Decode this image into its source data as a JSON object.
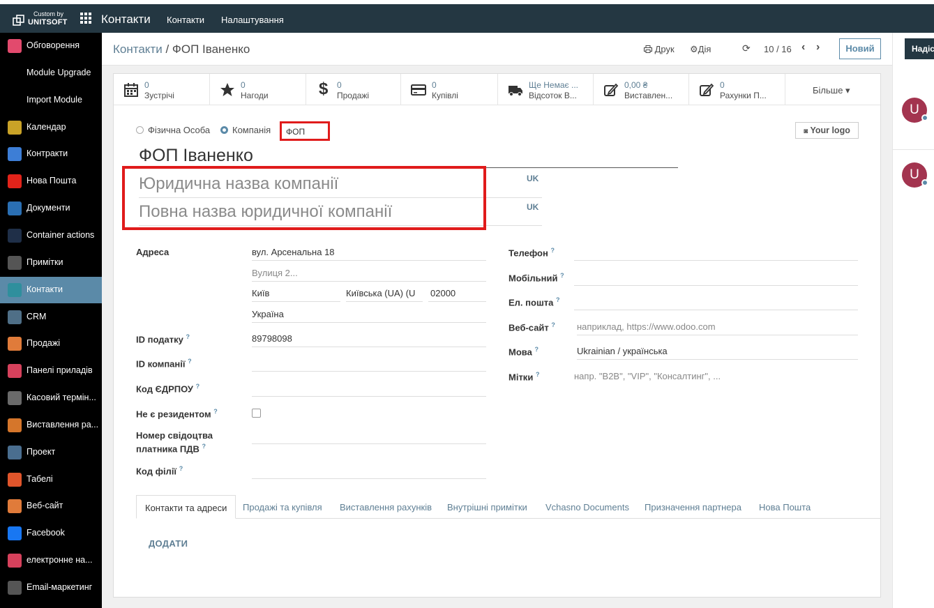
{
  "navbar": {
    "brand_small": "Custom by",
    "brand_big": "UNITSOFT",
    "title": "Контакти",
    "menu": [
      "Контакти",
      "Налаштування"
    ]
  },
  "sidebar": {
    "items": [
      {
        "label": "Обговорення",
        "icon": "chat-icon",
        "color": "#e24a6d"
      },
      {
        "label": "Module Upgrade",
        "icon": "none",
        "color": "#000000"
      },
      {
        "label": "Import Module",
        "icon": "none",
        "color": "#000000"
      },
      {
        "label": "Календар",
        "icon": "calendar-icon",
        "color": "#c9a227"
      },
      {
        "label": "Контракти",
        "icon": "contract-icon",
        "color": "#3d7ed6"
      },
      {
        "label": "Нова Пошта",
        "icon": "nova-poshta-icon",
        "color": "#e2231a"
      },
      {
        "label": "Документи",
        "icon": "documents-icon",
        "color": "#2a6fb3"
      },
      {
        "label": "Container actions",
        "icon": "container-icon",
        "color": "#1f2f48"
      },
      {
        "label": "Примітки",
        "icon": "notes-icon",
        "color": "#555555"
      },
      {
        "label": "Контакти",
        "icon": "contacts-icon",
        "color": "#2f8f9d",
        "active": true
      },
      {
        "label": "CRM",
        "icon": "crm-icon",
        "color": "#4f6f87"
      },
      {
        "label": "Продажі",
        "icon": "sales-icon",
        "color": "#e07b3a"
      },
      {
        "label": "Панелі приладів",
        "icon": "dashboard-icon",
        "color": "#d6415c"
      },
      {
        "label": "Касовий термін...",
        "icon": "pos-icon",
        "color": "#6a6a6a"
      },
      {
        "label": "Виставлення ра...",
        "icon": "invoicing-icon",
        "color": "#d5762b"
      },
      {
        "label": "Проект",
        "icon": "project-icon",
        "color": "#4a6e8f"
      },
      {
        "label": "Табелі",
        "icon": "timesheet-icon",
        "color": "#e0552b"
      },
      {
        "label": "Веб-сайт",
        "icon": "website-icon",
        "color": "#e07b3a"
      },
      {
        "label": "Facebook",
        "icon": "meta-icon",
        "color": "#1877f2"
      },
      {
        "label": "електронне на...",
        "icon": "e-doc-icon",
        "color": "#d6415c"
      },
      {
        "label": "Email-маркетинг",
        "icon": "email-marketing-icon",
        "color": "#555555"
      }
    ]
  },
  "control_panel": {
    "breadcrumb_link": "Контакти",
    "breadcrumb_sep": "/",
    "breadcrumb_current": "ФОП Іваненко",
    "print": "Друк",
    "action": "Дія",
    "pager": "10 / 16",
    "new": "Новий"
  },
  "smart_buttons": [
    {
      "value": "0",
      "label": "Зустрічі",
      "icon": "calendar-icon"
    },
    {
      "value": "0",
      "label": "Нагоди",
      "icon": "star-icon"
    },
    {
      "value": "0",
      "label": "Продажі",
      "icon": "dollar-icon"
    },
    {
      "value": "0",
      "label": "Купівлі",
      "icon": "credit-card-icon"
    },
    {
      "value": "Ще Немає ...",
      "label": "Відсоток В...",
      "icon": "truck-icon"
    },
    {
      "value": "0,00 ₴",
      "label": "Виставлен...",
      "icon": "edit-icon"
    },
    {
      "value": "0",
      "label": "Рахунки П...",
      "icon": "edit-icon"
    }
  ],
  "more": "Більше ▾",
  "form": {
    "radio_person": "Фізична Особа",
    "radio_company": "Компанія",
    "company_type_value": "ФОП",
    "logo_button": "Your logo",
    "name": "ФОП Іваненко",
    "legal_name_placeholder": "Юридична назва компанії",
    "full_legal_name_placeholder": "Повна назва юридичної компанії",
    "lang_badge": "UK",
    "left_fields": {
      "address_label": "Адреса",
      "street": "вул. Арсенальна 18",
      "street2_placeholder": "Вулиця 2...",
      "city": "Київ",
      "state": "Київська (UA) (U",
      "zip": "02000",
      "country": "Україна",
      "tax_id_label": "ID податку",
      "tax_id": "89798098",
      "company_id_label": "ID компанії",
      "edrpou_label": "Код ЄДРПОУ",
      "non_resident_label": "Не є резидентом",
      "vat_cert_label_1": "Номер свідоцтва",
      "vat_cert_label_2": "платника ПДВ",
      "branch_code_label": "Код філії"
    },
    "right_fields": {
      "phone_label": "Телефон",
      "mobile_label": "Мобільний",
      "email_label": "Ел. пошта",
      "website_label": "Веб-сайт",
      "website_placeholder": "наприклад, https://www.odoo.com",
      "lang_label": "Мова",
      "lang_value": "Ukrainian / українська",
      "tags_label": "Мітки",
      "tags_placeholder": "напр. \"B2B\", \"VIP\", \"Консалтинг\", ..."
    },
    "help_mark": "?"
  },
  "tabs": [
    "Контакти та адреси",
    "Продажі та купівля",
    "Виставлення рахунків",
    "Внутрішні примітки",
    "Vchasno Documents",
    "Призначення партнера",
    "Нова Пошта"
  ],
  "add_button": "ДОДАТИ",
  "chatter": {
    "send": "Надіслати",
    "avatar_letter": "U"
  },
  "colors": {
    "accent": "#5b8aa8",
    "navbar": "#243742",
    "highlight": "#e01b1b"
  }
}
